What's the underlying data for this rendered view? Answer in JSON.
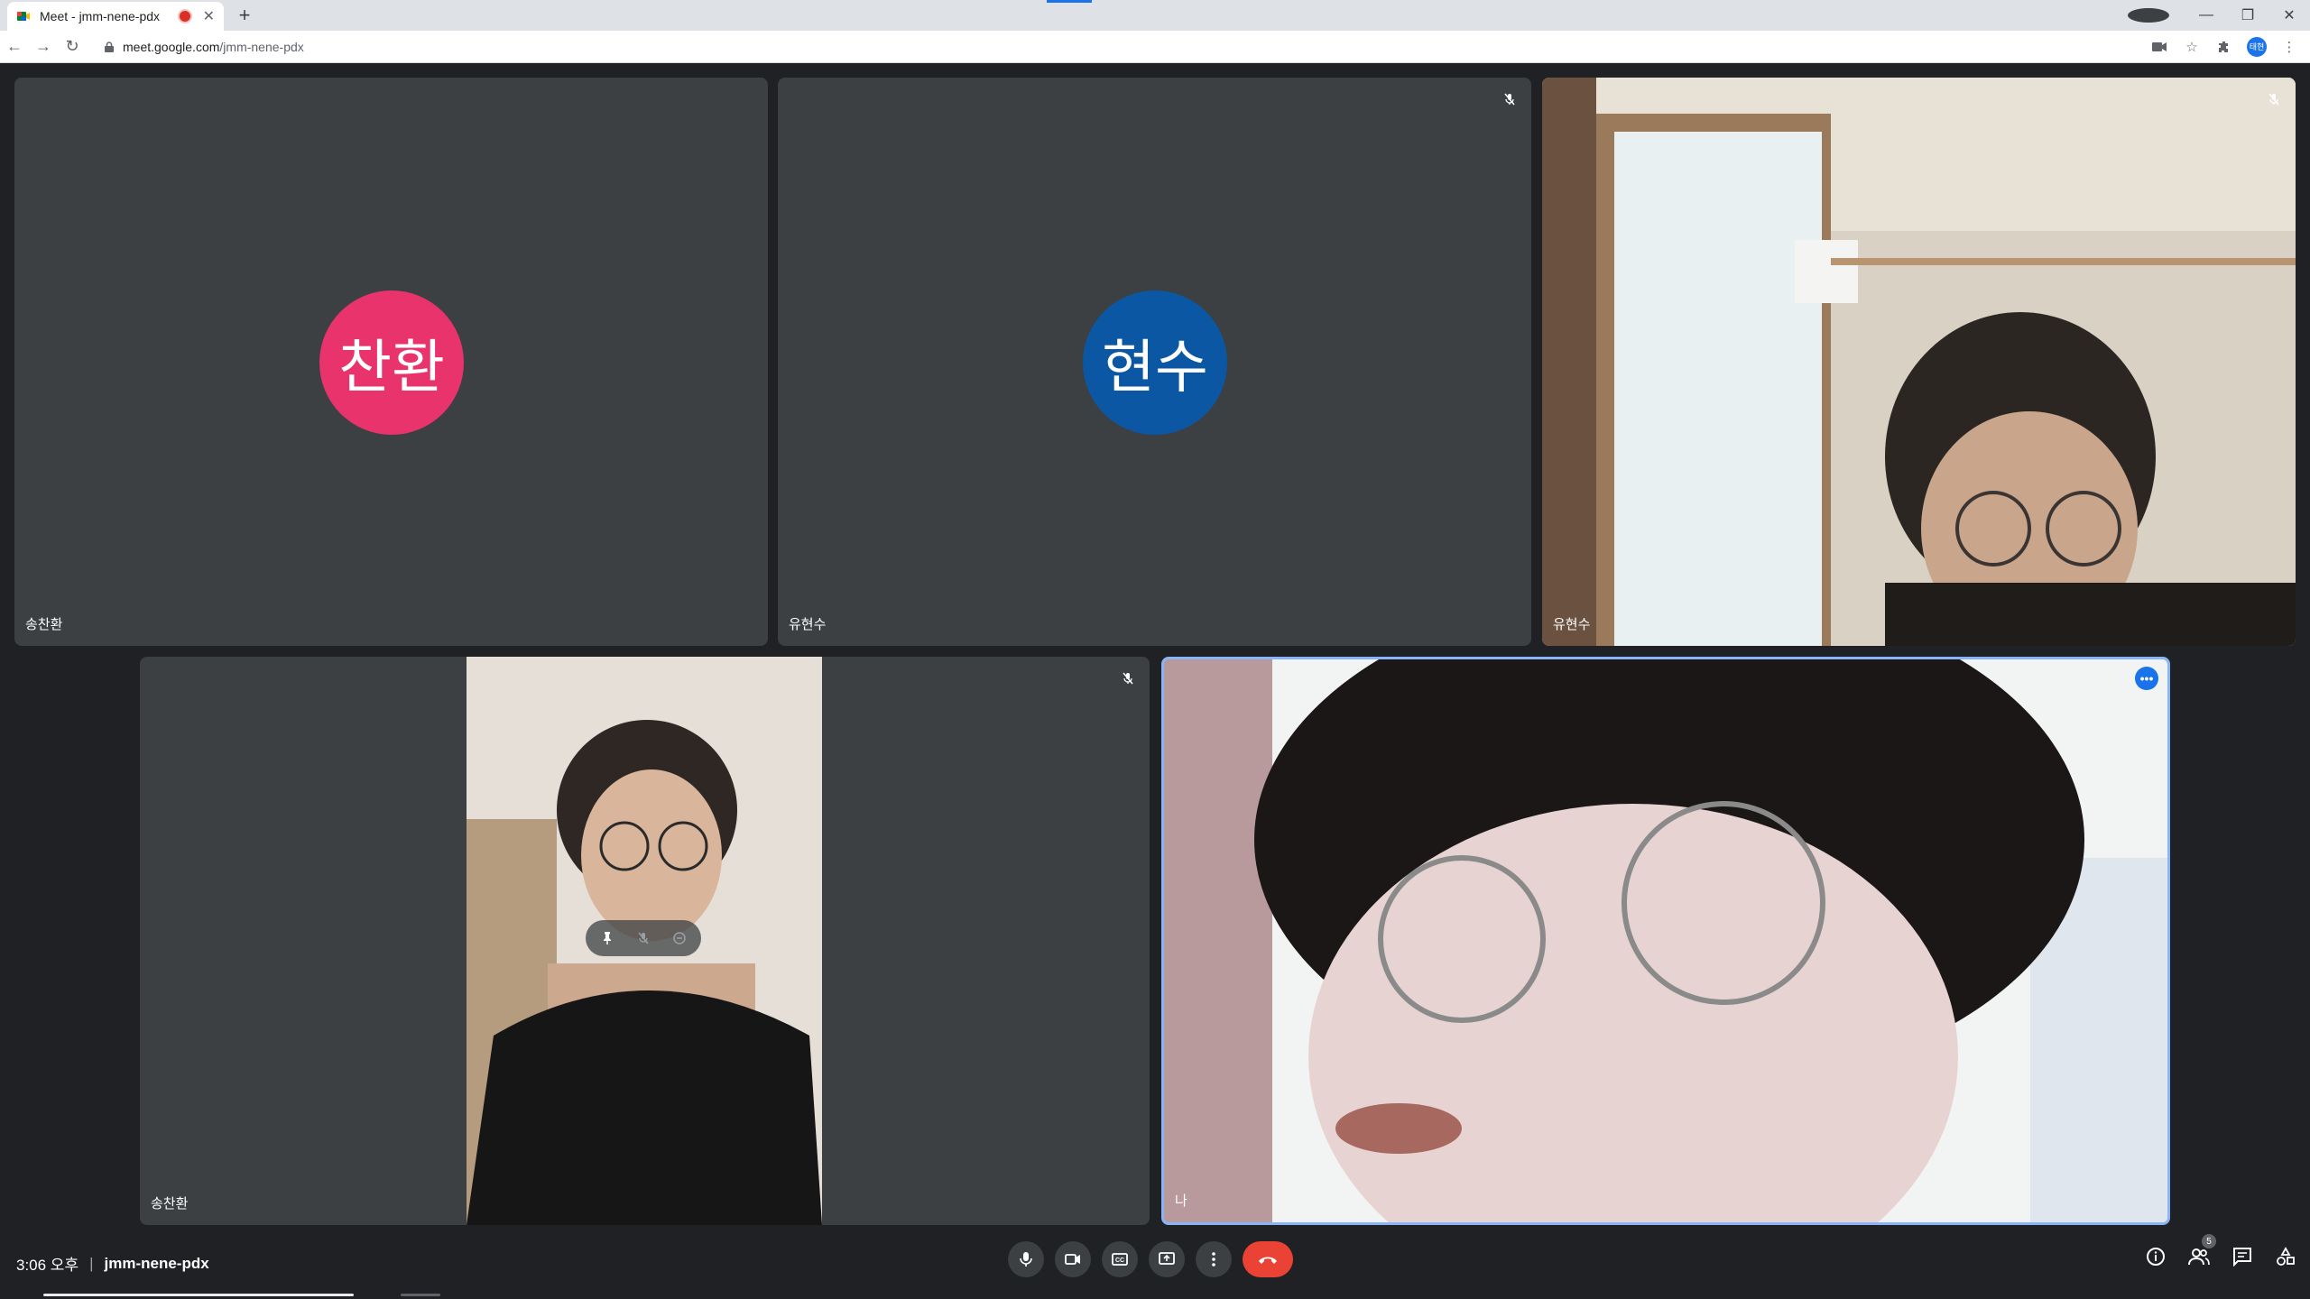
{
  "browser": {
    "tab_title": "Meet - jmm-nene-pdx",
    "url_host": "meet.google.com",
    "url_path": "/jmm-nene-pdx",
    "profile_label": "태현"
  },
  "tiles": {
    "top_left": {
      "name": "송찬환",
      "initials": "찬환",
      "avatar_color": "#e8336d"
    },
    "top_middle": {
      "name": "유현수",
      "initials": "현수",
      "avatar_color": "#0b57a4"
    },
    "top_right": {
      "name": "유현수"
    },
    "bottom_left": {
      "name": "송찬환"
    },
    "bottom_right": {
      "name": "나"
    }
  },
  "bottombar": {
    "time": "3:06 오후",
    "separator": "|",
    "meeting_code": "jmm-nene-pdx",
    "participants_count": "5"
  },
  "colors": {
    "background": "#202124",
    "tile_bg": "#3c4043",
    "end_call": "#ea4335",
    "accent": "#1a73e8"
  },
  "icons": {
    "mic": "microphone-icon",
    "camera": "video-camera-icon",
    "captions": "captions-icon",
    "present": "present-screen-icon",
    "more": "more-vert-icon",
    "end": "end-call-icon",
    "info": "info-icon",
    "people": "people-icon",
    "chat": "chat-icon",
    "activities": "activities-icon"
  }
}
